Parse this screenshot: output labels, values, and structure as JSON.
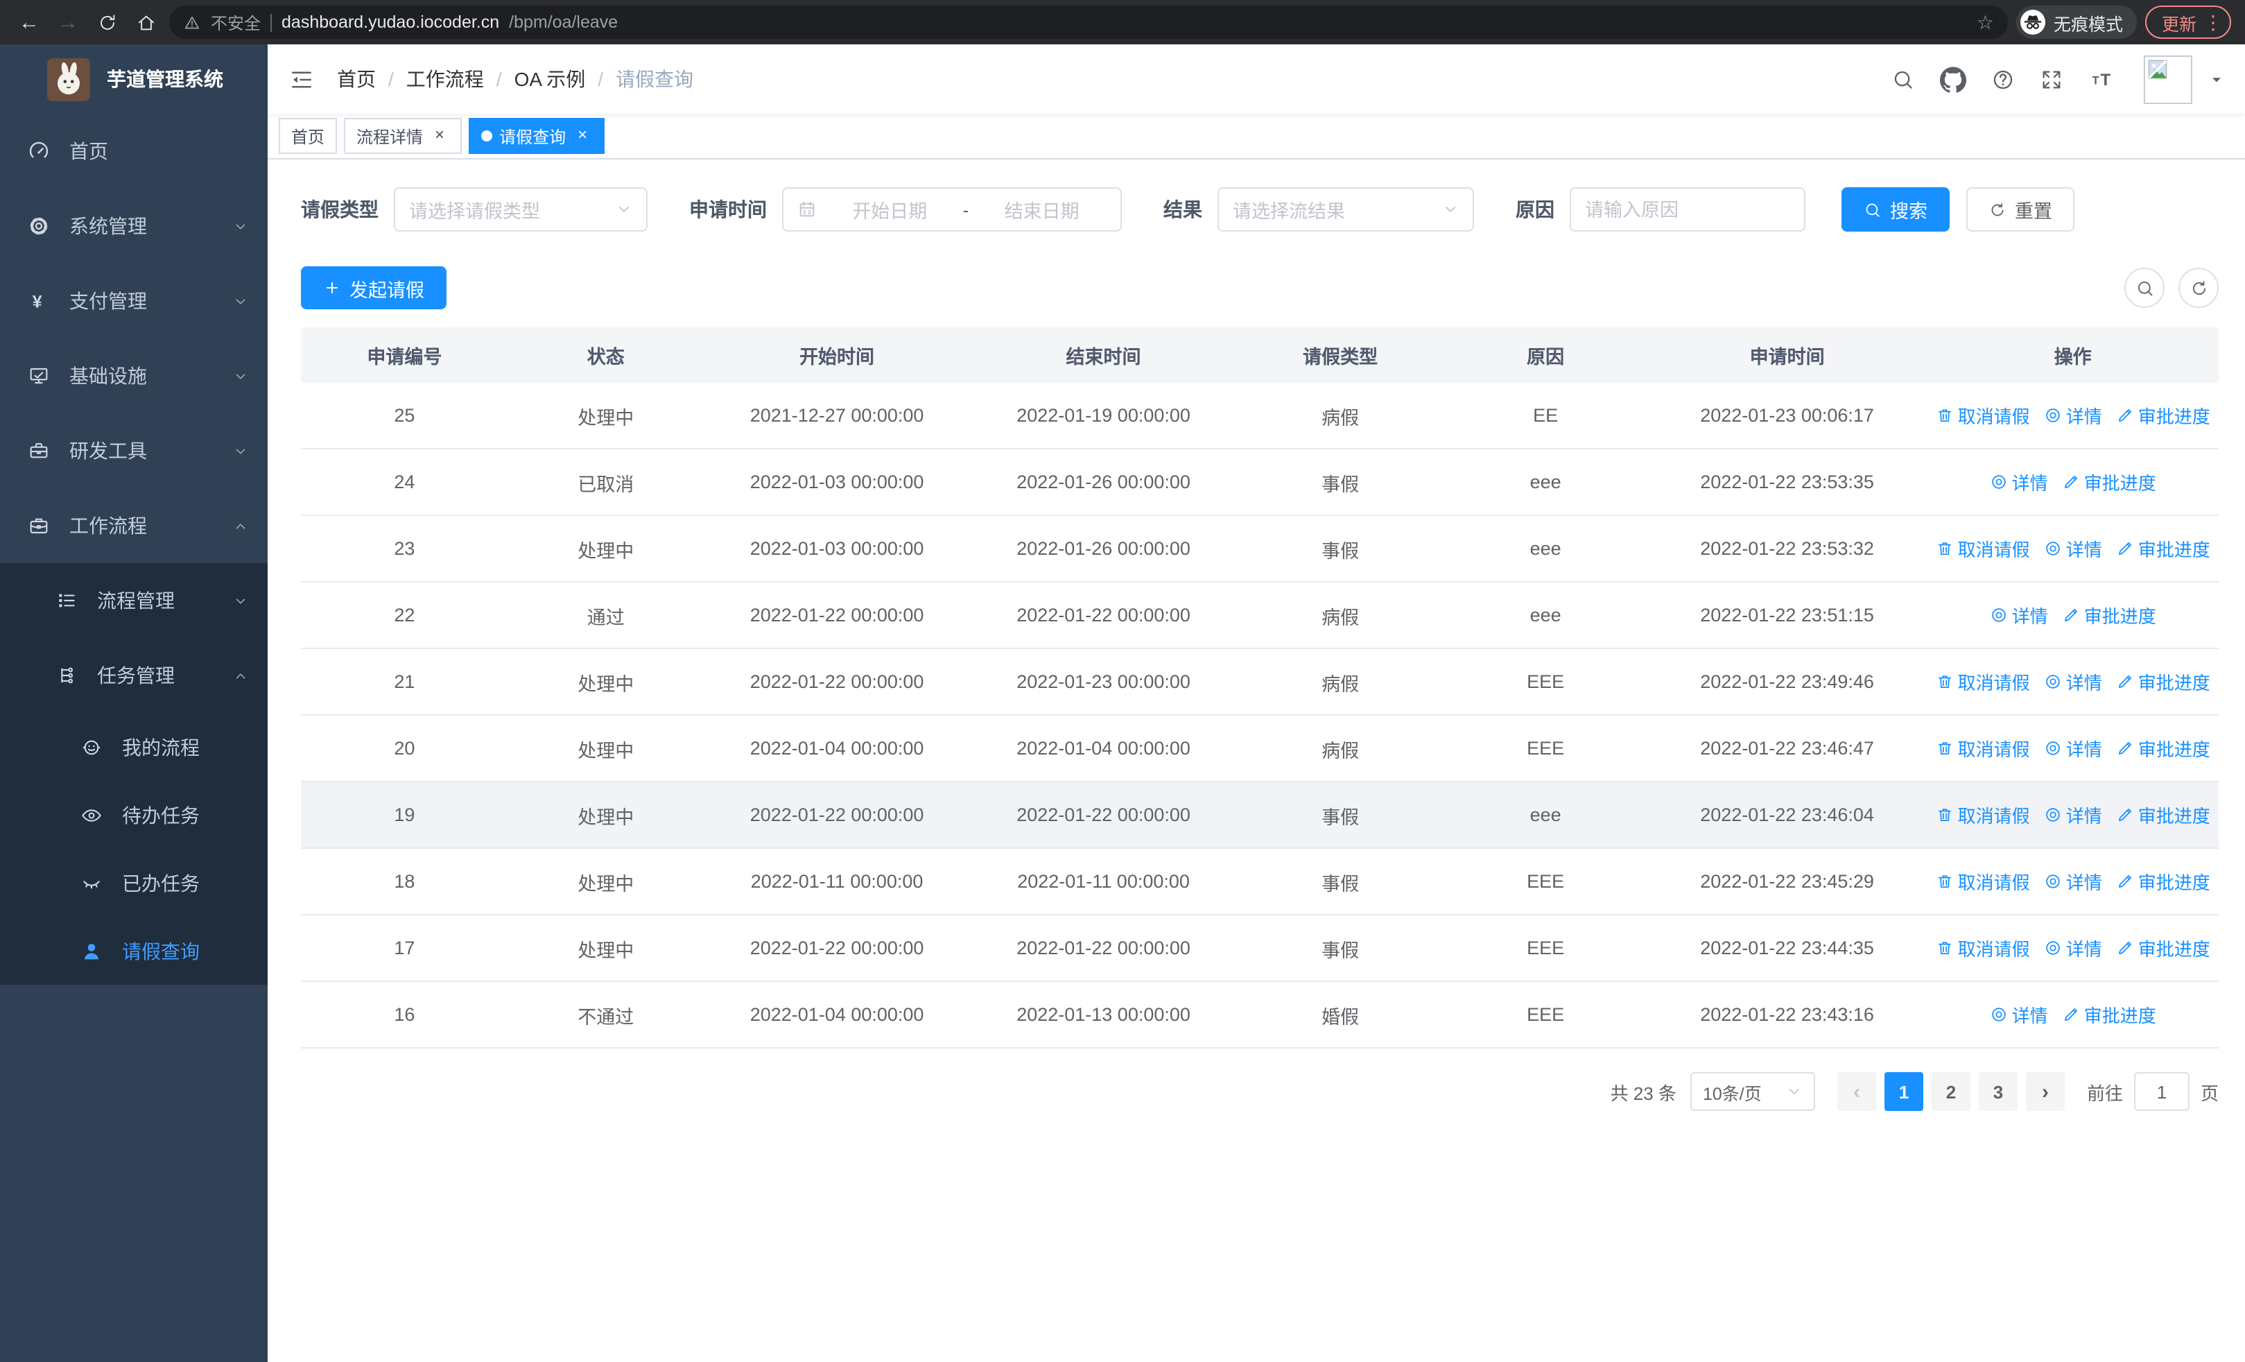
{
  "colors": {
    "primary": "#1890ff",
    "sidebar_bg": "#304156",
    "submenu_bg": "#1f2d3d",
    "sidebar_active": "#409eff",
    "update_accent": "#f28b82"
  },
  "browser": {
    "security_label": "不安全",
    "url_host": "dashboard.yudao.iocoder.cn",
    "url_path": "/bpm/oa/leave",
    "incognito_label": "无痕模式",
    "update_label": "更新"
  },
  "sidebar": {
    "logo_title": "芋道管理系统",
    "items": [
      {
        "key": "home",
        "label": "首页",
        "icon": "dashboard-icon",
        "level": 1
      },
      {
        "key": "system",
        "label": "系统管理",
        "icon": "gear-icon",
        "level": 1,
        "chevron": "down"
      },
      {
        "key": "payment",
        "label": "支付管理",
        "icon": "yen-icon",
        "level": 1,
        "chevron": "down"
      },
      {
        "key": "infrastructure",
        "label": "基础设施",
        "icon": "monitor-icon",
        "level": 1,
        "chevron": "down"
      },
      {
        "key": "devtools",
        "label": "研发工具",
        "icon": "toolbox-icon",
        "level": 1,
        "chevron": "down"
      },
      {
        "key": "workflow",
        "label": "工作流程",
        "icon": "briefcase-icon",
        "level": 1,
        "chevron": "up"
      },
      {
        "key": "process-mgmt",
        "label": "流程管理",
        "icon": "list-icon",
        "level": 2,
        "chevron": "down"
      },
      {
        "key": "task-mgmt",
        "label": "任务管理",
        "icon": "workflow-icon",
        "level": 2,
        "chevron": "up"
      },
      {
        "key": "my-process",
        "label": "我的流程",
        "icon": "robot-icon",
        "level": 3
      },
      {
        "key": "todo-tasks",
        "label": "待办任务",
        "icon": "eye-icon",
        "level": 3
      },
      {
        "key": "done-tasks",
        "label": "已办任务",
        "icon": "eye-closed-icon",
        "level": 3
      },
      {
        "key": "leave-query",
        "label": "请假查询",
        "icon": "user-icon",
        "level": 3,
        "active": true
      }
    ]
  },
  "breadcrumb": [
    "首页",
    "工作流程",
    "OA 示例",
    "请假查询"
  ],
  "breadcrumb_separator": "/",
  "tabs": [
    {
      "key": "home",
      "label": "首页",
      "closable": false,
      "active": false
    },
    {
      "key": "process-detail",
      "label": "流程详情",
      "closable": true,
      "active": false
    },
    {
      "key": "leave-query",
      "label": "请假查询",
      "closable": true,
      "active": true
    }
  ],
  "filters": {
    "leave_type_label": "请假类型",
    "leave_type_placeholder": "请选择请假类型",
    "apply_time_label": "申请时间",
    "start_date_placeholder": "开始日期",
    "date_separator": "-",
    "end_date_placeholder": "结束日期",
    "result_label": "结果",
    "result_placeholder": "请选择流结果",
    "reason_label": "原因",
    "reason_placeholder": "请输入原因",
    "search_label": "搜索",
    "reset_label": "重置"
  },
  "toolbar": {
    "create_label": "发起请假"
  },
  "table": {
    "columns": [
      "申请编号",
      "状态",
      "开始时间",
      "结束时间",
      "请假类型",
      "原因",
      "申请时间",
      "操作"
    ],
    "action_labels": {
      "cancel": "取消请假",
      "detail": "详情",
      "progress": "审批进度"
    },
    "rows": [
      {
        "id": "25",
        "status": "处理中",
        "start": "2021-12-27 00:00:00",
        "end": "2022-01-19 00:00:00",
        "type": "病假",
        "reason": "EE",
        "applied": "2022-01-23 00:06:17",
        "cancel": true,
        "highlight": false
      },
      {
        "id": "24",
        "status": "已取消",
        "start": "2022-01-03 00:00:00",
        "end": "2022-01-26 00:00:00",
        "type": "事假",
        "reason": "eee",
        "applied": "2022-01-22 23:53:35",
        "cancel": false,
        "highlight": false
      },
      {
        "id": "23",
        "status": "处理中",
        "start": "2022-01-03 00:00:00",
        "end": "2022-01-26 00:00:00",
        "type": "事假",
        "reason": "eee",
        "applied": "2022-01-22 23:53:32",
        "cancel": true,
        "highlight": false
      },
      {
        "id": "22",
        "status": "通过",
        "start": "2022-01-22 00:00:00",
        "end": "2022-01-22 00:00:00",
        "type": "病假",
        "reason": "eee",
        "applied": "2022-01-22 23:51:15",
        "cancel": false,
        "highlight": false
      },
      {
        "id": "21",
        "status": "处理中",
        "start": "2022-01-22 00:00:00",
        "end": "2022-01-23 00:00:00",
        "type": "病假",
        "reason": "EEE",
        "applied": "2022-01-22 23:49:46",
        "cancel": true,
        "highlight": false
      },
      {
        "id": "20",
        "status": "处理中",
        "start": "2022-01-04 00:00:00",
        "end": "2022-01-04 00:00:00",
        "type": "病假",
        "reason": "EEE",
        "applied": "2022-01-22 23:46:47",
        "cancel": true,
        "highlight": false
      },
      {
        "id": "19",
        "status": "处理中",
        "start": "2022-01-22 00:00:00",
        "end": "2022-01-22 00:00:00",
        "type": "事假",
        "reason": "eee",
        "applied": "2022-01-22 23:46:04",
        "cancel": true,
        "highlight": true
      },
      {
        "id": "18",
        "status": "处理中",
        "start": "2022-01-11 00:00:00",
        "end": "2022-01-11 00:00:00",
        "type": "事假",
        "reason": "EEE",
        "applied": "2022-01-22 23:45:29",
        "cancel": true,
        "highlight": false
      },
      {
        "id": "17",
        "status": "处理中",
        "start": "2022-01-22 00:00:00",
        "end": "2022-01-22 00:00:00",
        "type": "事假",
        "reason": "EEE",
        "applied": "2022-01-22 23:44:35",
        "cancel": true,
        "highlight": false
      },
      {
        "id": "16",
        "status": "不通过",
        "start": "2022-01-04 00:00:00",
        "end": "2022-01-13 00:00:00",
        "type": "婚假",
        "reason": "EEE",
        "applied": "2022-01-22 23:43:16",
        "cancel": false,
        "highlight": false
      }
    ]
  },
  "pagination": {
    "total_label": "共 23 条",
    "page_size": "10条/页",
    "pages": [
      "1",
      "2",
      "3"
    ],
    "active_page": "1",
    "jump_prefix": "前往",
    "jump_value": "1",
    "jump_suffix": "页"
  }
}
